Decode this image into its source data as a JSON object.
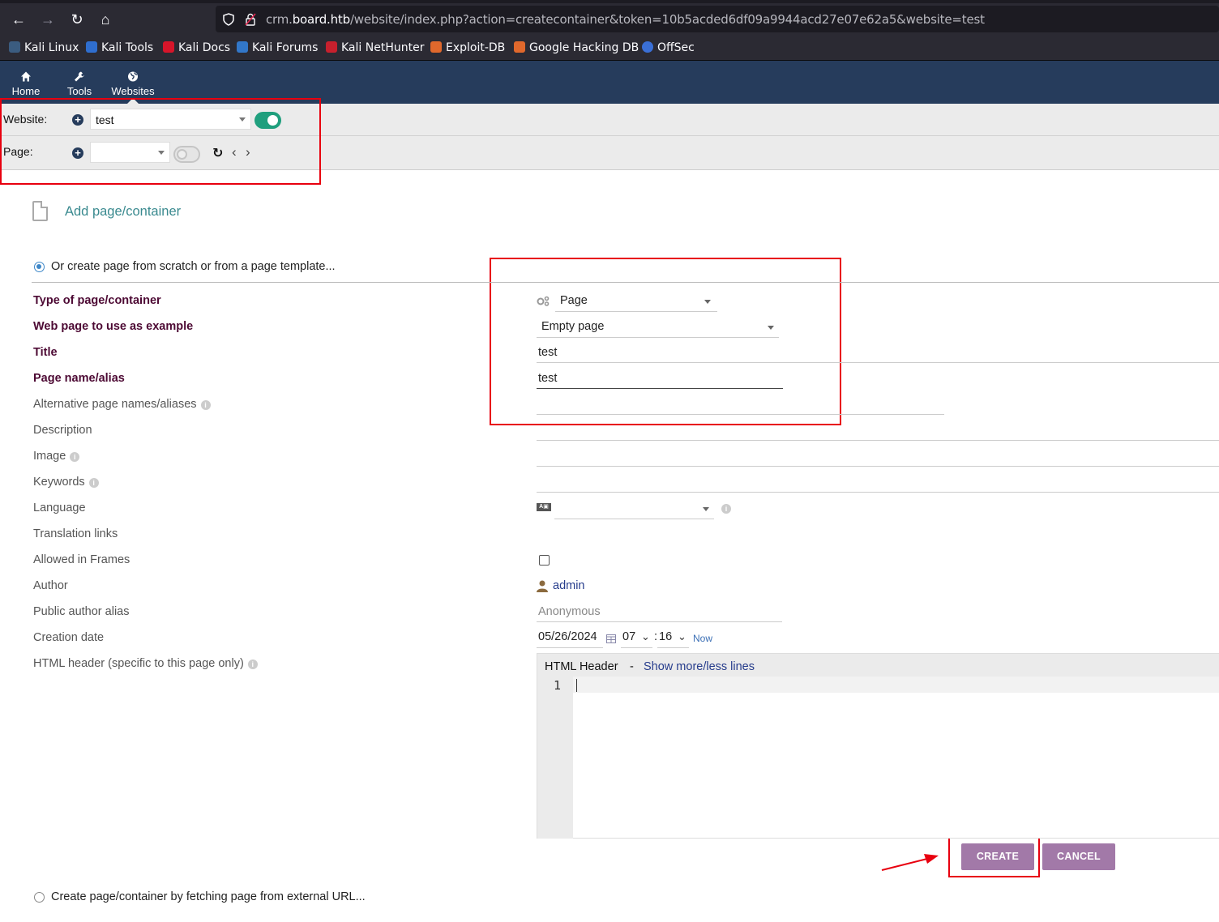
{
  "browser": {
    "url_prefix": "crm.",
    "url_host": "board.htb",
    "url_path": "/website/index.php?action=createcontainer&token=10b5acded6df09a9944acd27e07e62a5&website=test",
    "bookmarks": [
      "Kali Linux",
      "Kali Tools",
      "Kali Docs",
      "Kali Forums",
      "Kali NetHunter",
      "Exploit-DB",
      "Google Hacking DB",
      "OffSec"
    ]
  },
  "topmenu": [
    "Home",
    "Tools",
    "Websites"
  ],
  "website_bar": {
    "website_label": "Website:",
    "website_value": "test",
    "page_label": "Page:",
    "page_value": ""
  },
  "main": {
    "add_title": "Add page/container",
    "option_scratch": "Or create page from scratch or from a page template...",
    "option_fetch": "Create page/container by fetching page from external URL...",
    "fields": {
      "type_label": "Type of page/container",
      "type_value": "Page",
      "example_label": "Web page to use as example",
      "example_value": "Empty page",
      "title_label": "Title",
      "title_value": "test",
      "alias_label": "Page name/alias",
      "alias_value": "test",
      "alt_label": "Alternative page names/aliases",
      "desc_label": "Description",
      "image_label": "Image",
      "keywords_label": "Keywords",
      "language_label": "Language",
      "translation_label": "Translation links",
      "frames_label": "Allowed in Frames",
      "author_label": "Author",
      "author_value": "admin",
      "public_alias_label": "Public author alias",
      "public_alias_placeholder": "Anonymous",
      "creation_label": "Creation date",
      "creation_date": "05/26/2024",
      "creation_hour": "07",
      "creation_minute": "16",
      "now_label": "Now",
      "html_header_label": "HTML header (specific to this page only)"
    },
    "editor": {
      "title": "HTML Header",
      "separator": "-",
      "toggle_link": "Show more/less lines",
      "line_number": "1"
    },
    "buttons": {
      "create": "CREATE",
      "cancel": "CANCEL"
    }
  },
  "colors": {
    "header_bg": "#263c5c",
    "toggle_on": "#1f9f7d",
    "button_bg": "#a279a8",
    "annotation": "#e8000f",
    "required_label": "#4d0a34"
  }
}
